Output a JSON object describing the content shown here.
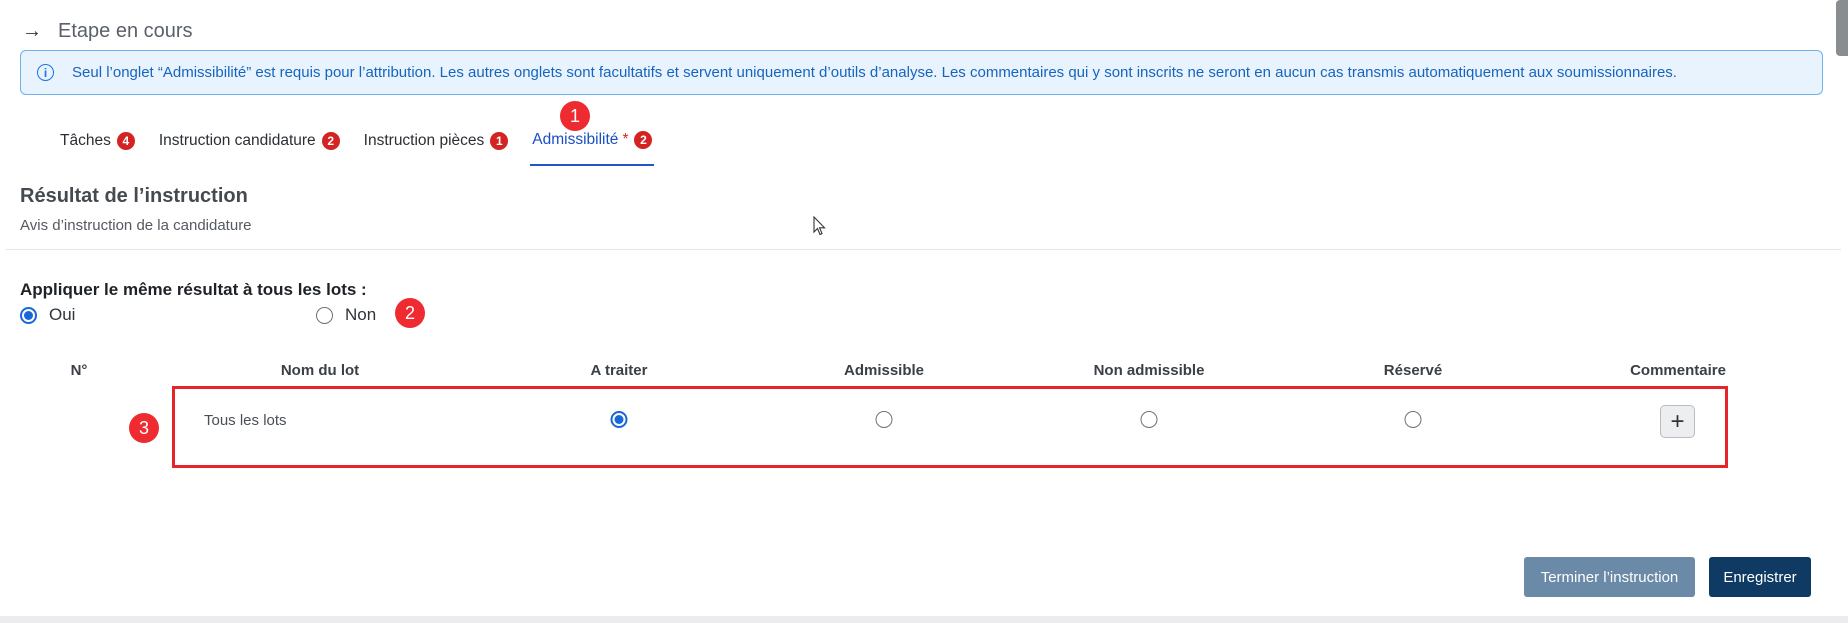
{
  "header": {
    "arrow_icon": "arrow-right-icon",
    "title": "Etape en cours"
  },
  "info": {
    "icon": "info-circle-icon",
    "text": "Seul l’onglet “Admissibilité” est requis pour l’attribution. Les autres onglets sont facultatifs et servent uniquement d’outils d’analyse. Les commentaires qui y sont inscrits ne seront en aucun cas transmis automatiquement aux soumissionnaires."
  },
  "tabs": [
    {
      "label": "Tâches",
      "badge": "4",
      "star": "",
      "active": false
    },
    {
      "label": "Instruction candidature",
      "badge": "2",
      "star": "",
      "active": false
    },
    {
      "label": "Instruction pièces",
      "badge": "1",
      "star": "",
      "active": false
    },
    {
      "label": "Admissibilité",
      "badge": "2",
      "star": "*",
      "active": true
    }
  ],
  "markers": {
    "m1": "1",
    "m2": "2",
    "m3": "3"
  },
  "section": {
    "title": "Résultat de l’instruction",
    "subtitle": "Avis d’instruction de la candidature"
  },
  "same_result": {
    "label": "Appliquer le même résultat à tous les lots :",
    "options": [
      {
        "label": "Oui",
        "checked": true
      },
      {
        "label": "Non",
        "checked": false
      }
    ]
  },
  "table": {
    "headers": {
      "num": "N°",
      "name": "Nom du lot",
      "a_traiter": "A traiter",
      "admissible": "Admissible",
      "non_admissible": "Non admissible",
      "reserve": "Réservé",
      "commentaire": "Commentaire"
    },
    "rows": [
      {
        "name": "Tous les lots",
        "selected": "a_traiter",
        "comment_icon": "plus-icon"
      }
    ]
  },
  "actions": {
    "finish": "Terminer l’instruction",
    "save": "Enregistrer"
  },
  "colors": {
    "accent": "#1a67d8",
    "badge": "#d32323",
    "primary_button": "#0e3a63",
    "secondary_button": "#6a8aa7",
    "highlight": "#e8242b"
  }
}
